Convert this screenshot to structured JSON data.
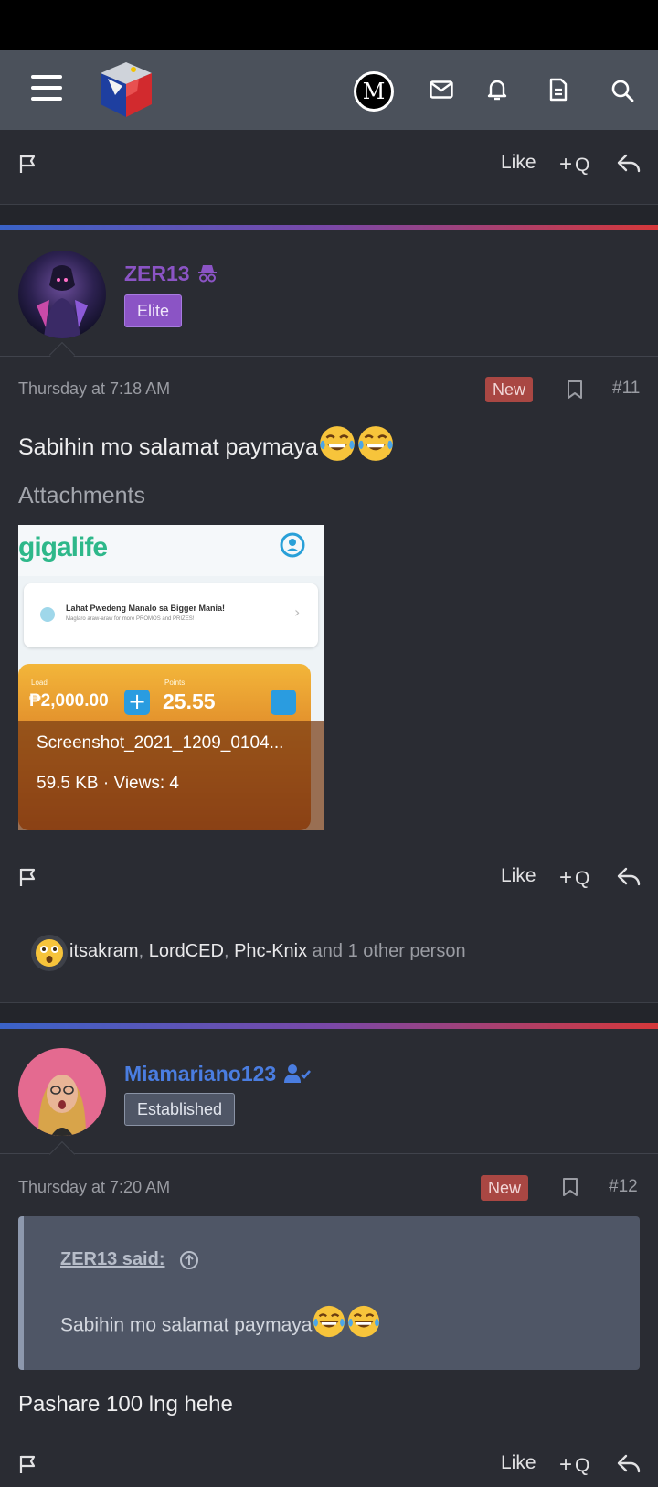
{
  "header": {
    "menu_icon": "hamburger-icon",
    "logo_icon": "philippine-cube-logo",
    "avatar_letter": "M",
    "icons": [
      "mail-icon",
      "bell-icon",
      "document-icon",
      "search-icon"
    ]
  },
  "actions": {
    "like": "Like",
    "quote": "Q",
    "quote_plus": "+"
  },
  "post11": {
    "username": "ZER13",
    "username_color": "#8b54c5",
    "role": "Elite",
    "date": "Thursday at 7:18 AM",
    "badge": "New",
    "number": "#11",
    "text": "Sabihin mo salamat paymaya",
    "emoji": "face-with-tears-of-joy",
    "attachments_title": "Attachments",
    "attachment": {
      "app_name": "gigalife",
      "promo": "Lahat Pwedeng Manalo sa Bigger Mania!",
      "promo_sub": "Maglaro araw-araw for more PROMOS and PRIZES!",
      "load_label": "Load",
      "load_value": "₱2,000.00",
      "points_label": "Points",
      "points_value": "25.55",
      "filename": "Screenshot_2021_1209_0104...",
      "meta": "59.5 KB · Views: 4"
    },
    "reactions": {
      "users": [
        {
          "name": "itsakram",
          "sep": ", "
        },
        {
          "name": "LordCED",
          "sep": ", "
        },
        {
          "name": "Phc-Knix",
          "sep": ""
        }
      ],
      "others": " and 1 other person"
    }
  },
  "post12": {
    "username": "Miamariano123",
    "username_color": "#4a7de0",
    "role": "Established",
    "date": "Thursday at 7:20 AM",
    "badge": "New",
    "number": "#12",
    "quote_author": "ZER13 said:",
    "quote_text": "Sabihin mo salamat paymaya",
    "text": "Pashare 100 lng hehe"
  },
  "colors": {
    "accent_gradient_start": "#3a63c8",
    "accent_gradient_end": "#d5383a",
    "new_badge": "#a94743"
  }
}
